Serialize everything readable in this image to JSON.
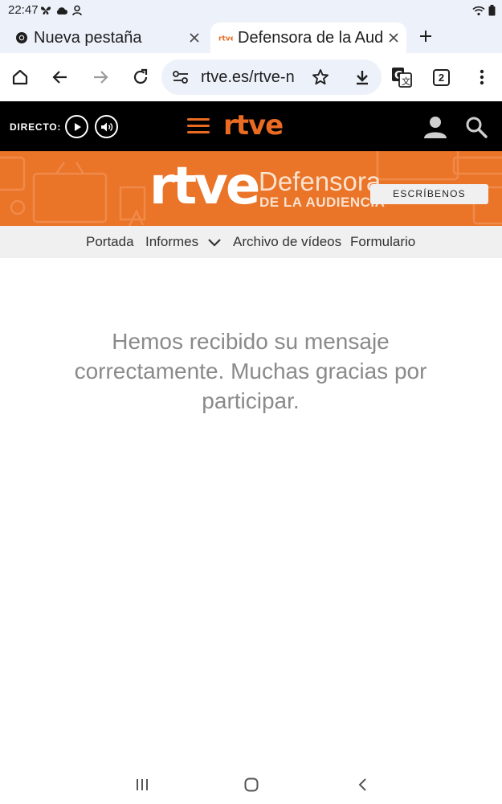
{
  "status_bar": {
    "time": "22:47",
    "left_icons": [
      "butterfly-icon",
      "cloud-icon",
      "person-icon"
    ],
    "right_icons": [
      "wifi-icon",
      "battery-icon"
    ]
  },
  "tabs": [
    {
      "title": "Nueva pestaña",
      "favicon": "chrome-icon",
      "active": false
    },
    {
      "title": "Defensora de la Audiencia",
      "favicon": "rtve-favicon",
      "active": true
    }
  ],
  "toolbar": {
    "url": "rtve.es/rtve-n",
    "tab_count": "2"
  },
  "rtve_header": {
    "directo_label": "DIRECTO:",
    "logo_text": "rtve"
  },
  "banner": {
    "logo_text": "rtve",
    "title": "Defensora",
    "subtitle": "DE LA AUDIENCIA",
    "cta_label": "ESCRÍBENOS"
  },
  "nav": {
    "items": [
      {
        "label": "Portada"
      },
      {
        "label": "Informes"
      },
      {
        "label": "Archivo de vídeos"
      },
      {
        "label": "Formulario"
      }
    ]
  },
  "main": {
    "message": "Hemos recibido su mensaje correctamente. Muchas gracias por participar."
  },
  "colors": {
    "brand_orange": "#ea7428",
    "header_black": "#000000",
    "nav_gray": "#f0f0f0"
  }
}
